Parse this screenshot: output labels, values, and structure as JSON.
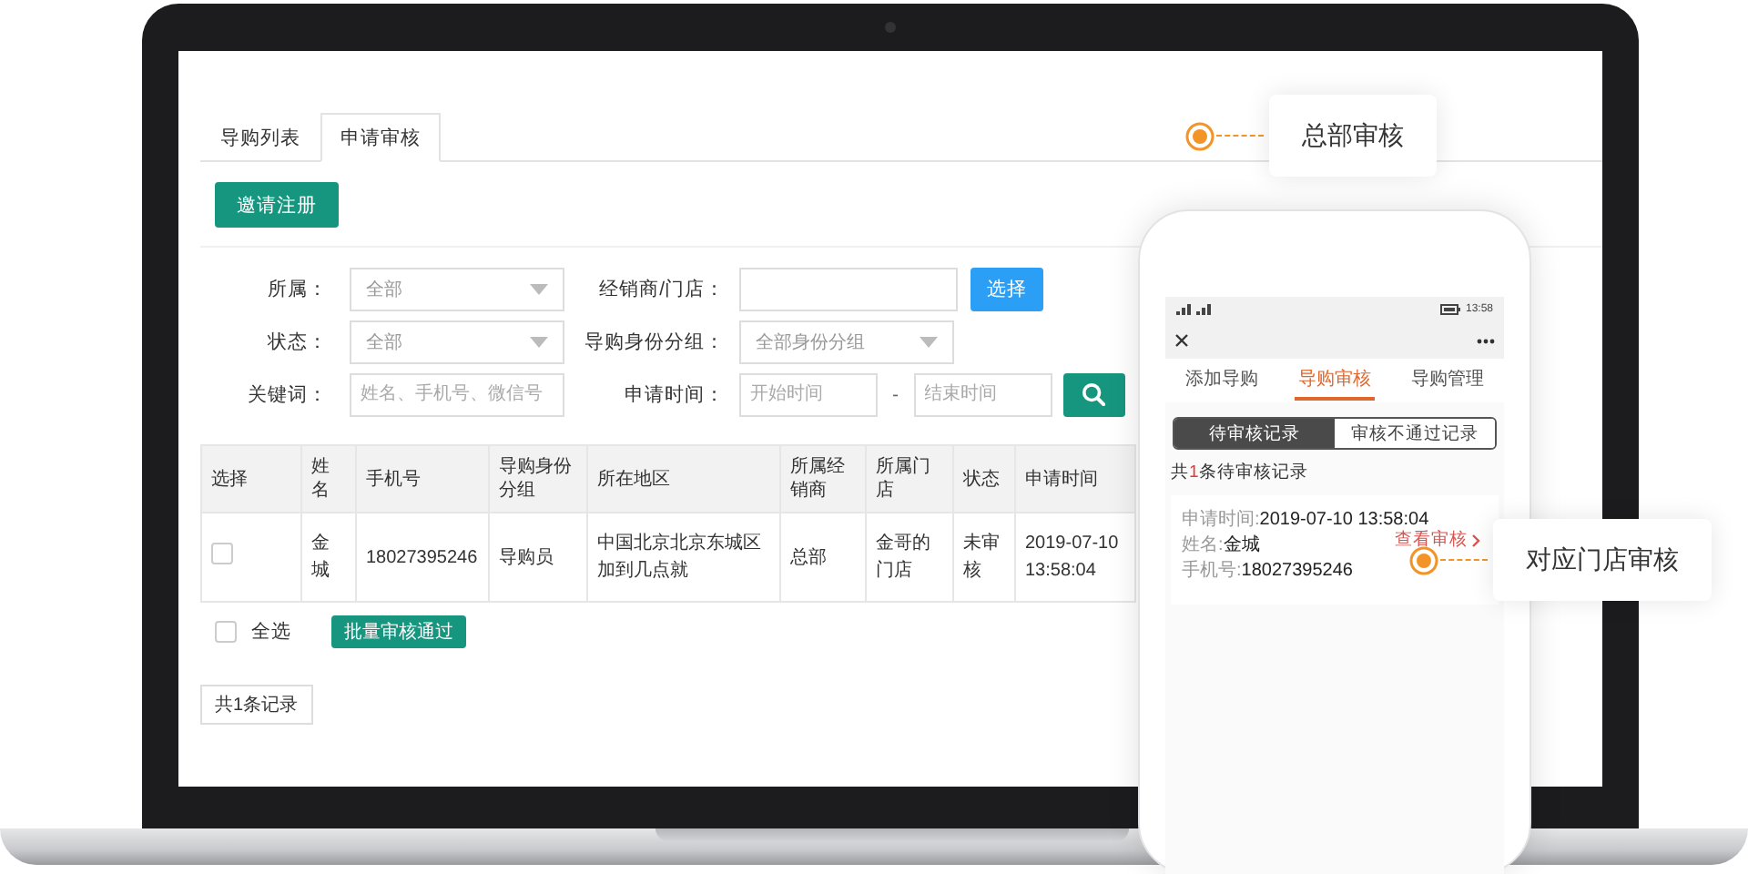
{
  "admin": {
    "tabs": [
      {
        "label": "导购列表",
        "selected": false
      },
      {
        "label": "申请审核",
        "selected": true
      }
    ],
    "invite_button": "邀请注册",
    "filter_rows": [
      {
        "left": {
          "label": "所属：",
          "kind": "select",
          "value": "全部"
        },
        "right": {
          "label": "经销商/门店：",
          "kind": "picker",
          "button": "选择"
        }
      },
      {
        "left": {
          "label": "状态：",
          "kind": "select",
          "value": "全部"
        },
        "right": {
          "label": "导购身份分组：",
          "kind": "select",
          "value": "全部身份分组"
        }
      },
      {
        "left": {
          "label": "关键词：",
          "kind": "input",
          "placeholder": "姓名、手机号、微信号"
        },
        "right": {
          "label": "申请时间：",
          "kind": "range",
          "placeholder": "开始时间",
          "separator": "-",
          "placeholder_end": "结束时间"
        }
      }
    ],
    "table": {
      "columns": [
        "选择",
        "姓名",
        "手机号",
        "导购身份分组",
        "所在地区",
        "所属经销商",
        "所属门店",
        "状态",
        "申请时间"
      ],
      "rows": [
        {
          "checked": false,
          "cells": [
            "",
            "金城",
            "18027395246",
            "导购员",
            "中国北京北京东城区加到几点就",
            "总部",
            "金哥的门店",
            "未审核",
            "2019-07-10 13:58:04"
          ]
        }
      ]
    },
    "select_all": {
      "label": "全选",
      "checked": false
    },
    "batch_button": "批量审核通过",
    "record_count": "共1条记录"
  },
  "phone": {
    "status_time": "13:58",
    "tabs": [
      {
        "label": "添加导购",
        "selected": false
      },
      {
        "label": "导购审核",
        "selected": true
      },
      {
        "label": "导购管理",
        "selected": false
      }
    ],
    "segments": [
      {
        "label": "待审核记录",
        "selected": true
      },
      {
        "label": "审核不通过记录",
        "selected": false
      }
    ],
    "summary": {
      "before": "共",
      "count": "1",
      "after": "条待审核记录"
    },
    "card": {
      "lines": [
        {
          "label": "申请时间:",
          "value": "2019-07-10 13:58:04"
        },
        {
          "label": "姓名:",
          "value": "金城"
        },
        {
          "label": "手机号:",
          "value": "18027395246"
        }
      ],
      "link": "查看审核"
    }
  },
  "callouts": [
    {
      "text": "总部审核"
    },
    {
      "text": "对应门店审核"
    }
  ]
}
